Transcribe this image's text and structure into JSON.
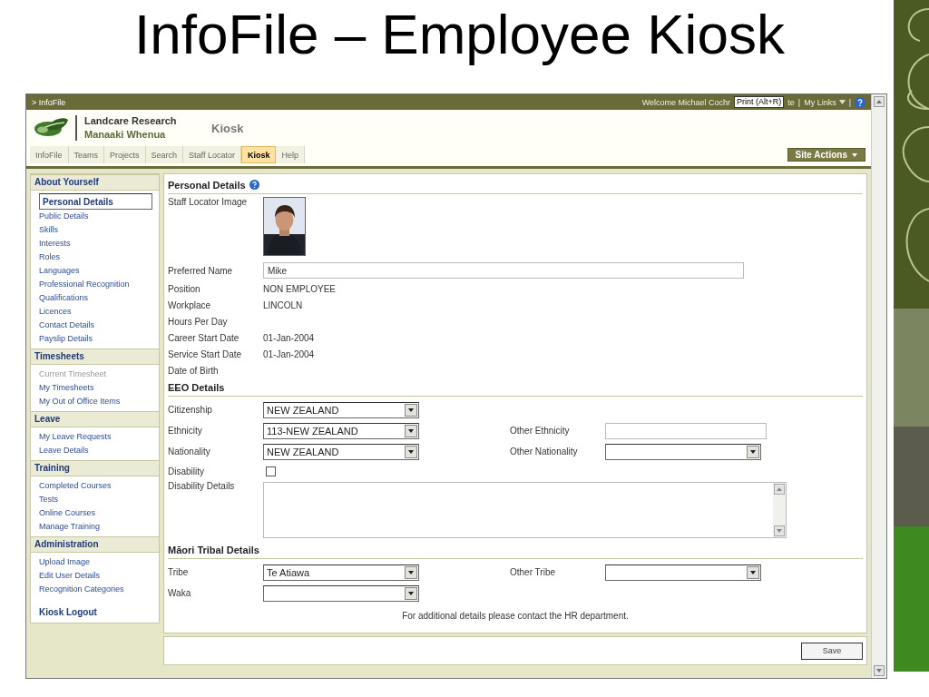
{
  "slide_title": "InfoFile – Employee Kiosk",
  "top_bar": {
    "breadcrumb": "> InfoFile",
    "welcome": "Welcome Michael Cochr",
    "tooltip": "Print (Alt+R)",
    "welcome_rest": "te",
    "separator_1": "|",
    "my_links": "My Links",
    "separator_2": "|"
  },
  "brand": {
    "line_1": "Landcare Research",
    "line_2": "Manaaki Whenua",
    "page_title": "Kiosk"
  },
  "tabs": [
    {
      "label": "InfoFile",
      "selected": false
    },
    {
      "label": "Teams",
      "selected": false
    },
    {
      "label": "Projects",
      "selected": false
    },
    {
      "label": "Search",
      "selected": false
    },
    {
      "label": "Staff Locator",
      "selected": false
    },
    {
      "label": "Kiosk",
      "selected": true
    },
    {
      "label": "Help",
      "selected": false
    }
  ],
  "site_actions": "Site Actions",
  "sidebar": {
    "sections": [
      {
        "heading": "About Yourself",
        "items": [
          {
            "label": "Personal Details",
            "selected": true,
            "disabled": false
          },
          {
            "label": "Public Details",
            "selected": false,
            "disabled": false
          },
          {
            "label": "Skills",
            "selected": false,
            "disabled": false
          },
          {
            "label": "Interests",
            "selected": false,
            "disabled": false
          },
          {
            "label": "Roles",
            "selected": false,
            "disabled": false
          },
          {
            "label": "Languages",
            "selected": false,
            "disabled": false
          },
          {
            "label": "Professional Recognition",
            "selected": false,
            "disabled": false
          },
          {
            "label": "Qualifications",
            "selected": false,
            "disabled": false
          },
          {
            "label": "Licences",
            "selected": false,
            "disabled": false
          },
          {
            "label": "Contact Details",
            "selected": false,
            "disabled": false
          },
          {
            "label": "Payslip Details",
            "selected": false,
            "disabled": false
          }
        ]
      },
      {
        "heading": "Timesheets",
        "items": [
          {
            "label": "Current Timesheet",
            "selected": false,
            "disabled": true
          },
          {
            "label": "My Timesheets",
            "selected": false,
            "disabled": false
          },
          {
            "label": "My Out of Office Items",
            "selected": false,
            "disabled": false
          }
        ]
      },
      {
        "heading": "Leave",
        "items": [
          {
            "label": "My Leave Requests",
            "selected": false,
            "disabled": false
          },
          {
            "label": "Leave Details",
            "selected": false,
            "disabled": false
          }
        ]
      },
      {
        "heading": "Training",
        "items": [
          {
            "label": "Completed Courses",
            "selected": false,
            "disabled": false
          },
          {
            "label": "Tests",
            "selected": false,
            "disabled": false
          },
          {
            "label": "Online Courses",
            "selected": false,
            "disabled": false
          },
          {
            "label": "Manage Training",
            "selected": false,
            "disabled": false
          }
        ]
      },
      {
        "heading": "Administration",
        "items": [
          {
            "label": "Upload Image",
            "selected": false,
            "disabled": false
          },
          {
            "label": "Edit User Details",
            "selected": false,
            "disabled": false
          },
          {
            "label": "Recognition Categories",
            "selected": false,
            "disabled": false
          }
        ]
      }
    ],
    "logout": "Kiosk Logout"
  },
  "main": {
    "sections": [
      {
        "heading": "Personal Details",
        "help": true,
        "rows": [
          {
            "label": "Staff Locator Image"
          },
          {
            "kind": "input",
            "label": "Preferred Name",
            "value": "Mike"
          },
          {
            "kind": "text",
            "label": "Position",
            "value": "NON EMPLOYEE"
          },
          {
            "kind": "text",
            "label": "Workplace",
            "value": "LINCOLN"
          },
          {
            "kind": "text",
            "label": "Hours Per Day"
          },
          {
            "kind": "text",
            "label": "Career Start Date",
            "value": "01-Jan-2004"
          },
          {
            "kind": "text",
            "label": "Service Start Date",
            "value": "01-Jan-2004"
          },
          {
            "kind": "text",
            "label": "Date of Birth"
          }
        ]
      },
      {
        "heading": "EEO Details",
        "rows": [
          {
            "kind": "select",
            "label": "Citizenship",
            "value": "NEW ZEALAND"
          },
          {
            "kind": "select",
            "label": "Ethnicity",
            "value": "113-NEW ZEALAND",
            "other": {
              "kind": "input",
              "label": "Other Ethnicity"
            }
          },
          {
            "kind": "select",
            "label": "Nationality",
            "value": "NEW ZEALAND",
            "other": {
              "kind": "select",
              "label": "Other Nationality"
            }
          },
          {
            "kind": "checkbox",
            "label": "Disability",
            "checked": false
          },
          {
            "kind": "textarea",
            "label": "Disability Details"
          }
        ]
      },
      {
        "heading": "Māori Tribal Details",
        "rows": [
          {
            "kind": "select",
            "label": "Tribe",
            "value": "Te Atiawa",
            "other": {
              "kind": "select",
              "label": "Other Tribe"
            }
          },
          {
            "kind": "select",
            "label": "Waka"
          }
        ]
      }
    ],
    "note": "For additional details please contact the HR department.",
    "save": "Save"
  }
}
